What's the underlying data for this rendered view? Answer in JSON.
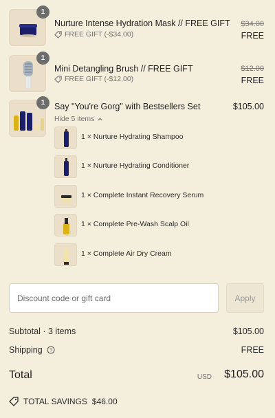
{
  "items": [
    {
      "title": "Nurture Intense Hydration Mask // FREE GIFT",
      "quantity": "1",
      "discount": "FREE GIFT (-$34.00)",
      "original_price": "$34.00",
      "price": "FREE"
    },
    {
      "title": "Mini Detangling Brush // FREE GIFT",
      "quantity": "1",
      "discount": "FREE GIFT (-$12.00)",
      "original_price": "$12.00",
      "price": "FREE"
    },
    {
      "title": "Say \"You're Gorg\" with Bestsellers Set",
      "quantity": "1",
      "price": "$105.00",
      "toggle_label": "Hide 5 items",
      "components": [
        "1 × Nurture Hydrating Shampoo",
        "1 × Nurture Hydrating Conditioner",
        "1 × Complete Instant Recovery Serum",
        "1 × Complete Pre-Wash Scalp Oil",
        "1 × Complete Air Dry Cream"
      ]
    }
  ],
  "discount": {
    "placeholder": "Discount code or gift card",
    "apply_label": "Apply"
  },
  "summary": {
    "subtotal_label": "Subtotal · 3 items",
    "subtotal_value": "$105.00",
    "shipping_label": "Shipping",
    "shipping_value": "FREE",
    "total_label": "Total",
    "currency": "USD",
    "total_value": "$105.00",
    "savings_label": "TOTAL SAVINGS",
    "savings_value": "$46.00"
  },
  "colors": {
    "background": "#f4eedc",
    "thumbnail": "#ebdfc9",
    "badge": "#6d6d6d",
    "text": "#2a2a2a",
    "muted": "#6f6f6f"
  }
}
